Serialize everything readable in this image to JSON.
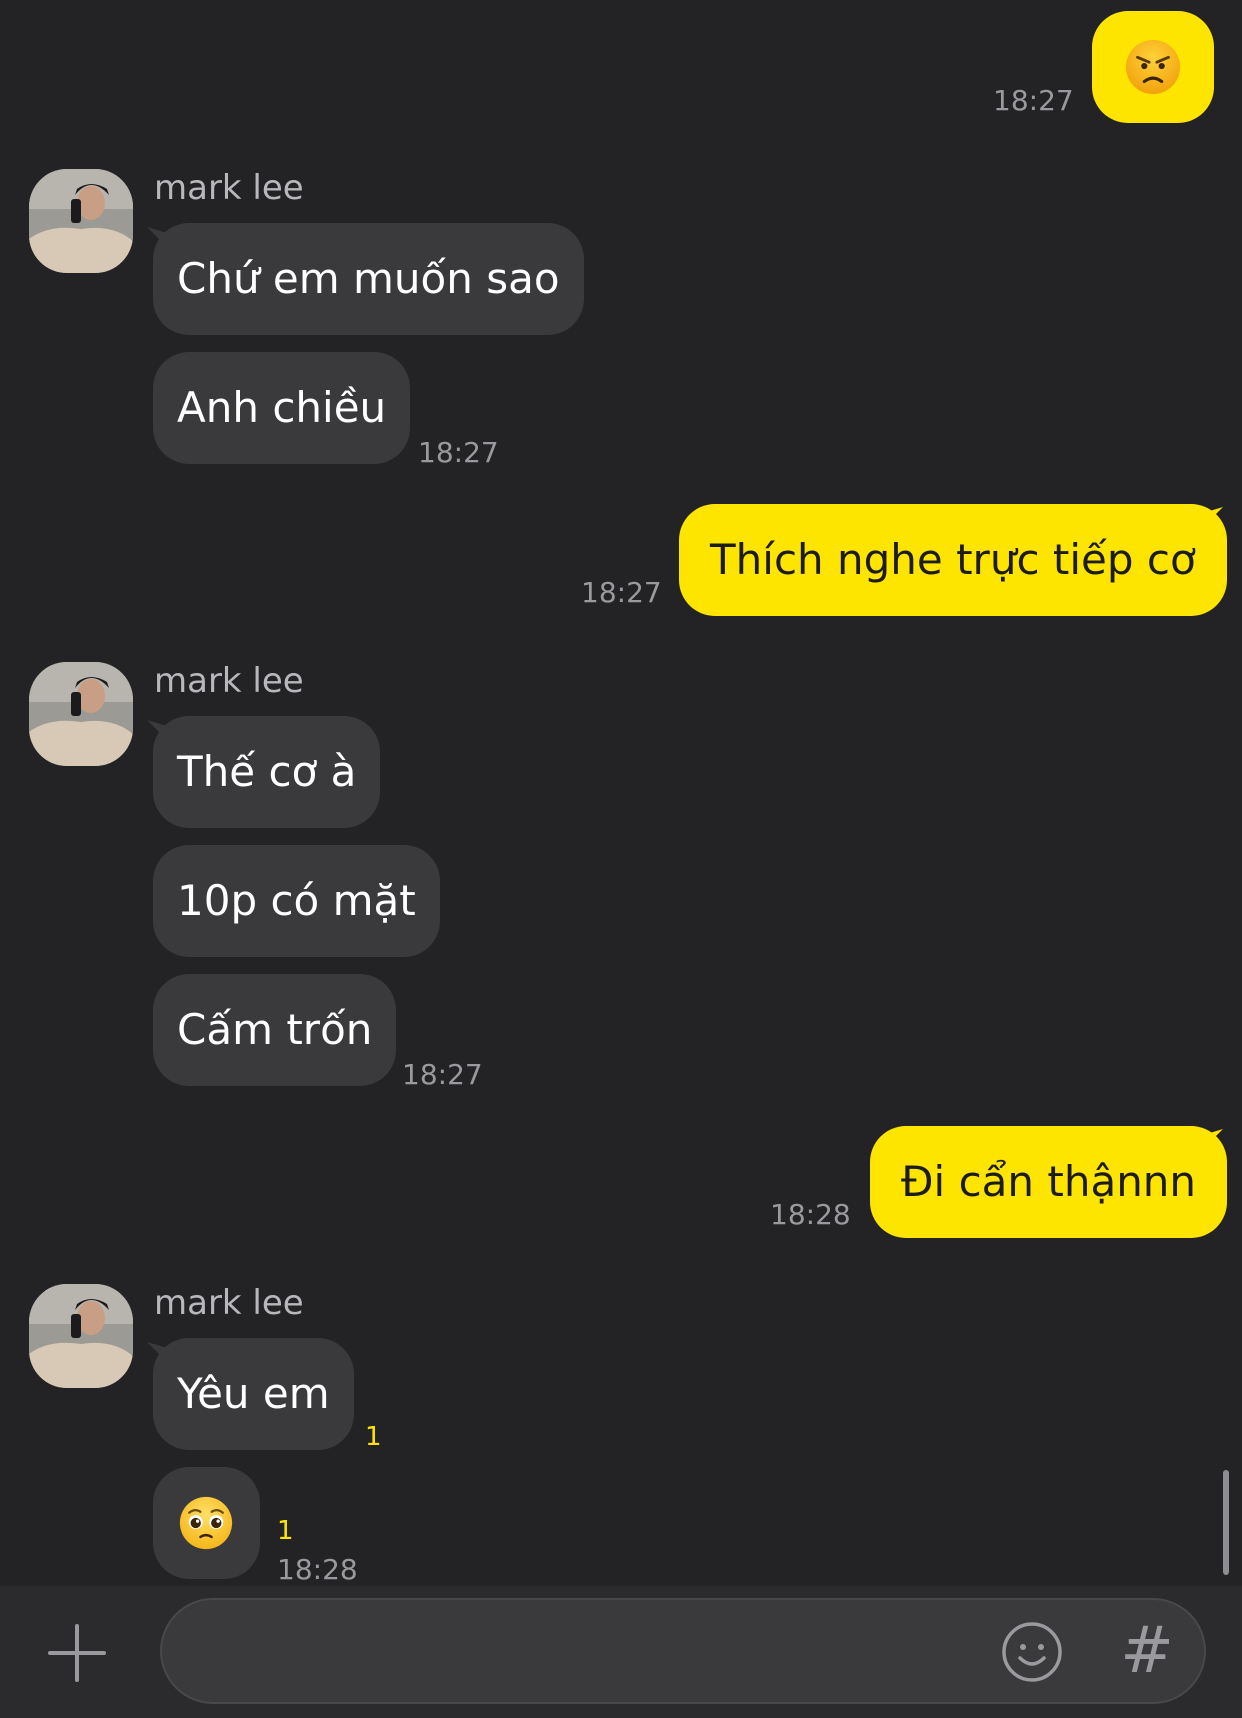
{
  "app": {
    "accent_color": "#fee500",
    "background_color": "#232326",
    "incoming_bubble_color": "#3a3a3d"
  },
  "messages": {
    "m1": {
      "direction": "outgoing",
      "emoji": "pouting-face",
      "time": "18:27"
    },
    "group1": {
      "sender": "mark lee",
      "bubble1": "Chứ em muốn sao",
      "bubble2": "Anh chiều",
      "time": "18:27"
    },
    "m2": {
      "direction": "outgoing",
      "text": "Thích nghe trực tiếp cơ",
      "time": "18:27"
    },
    "group2": {
      "sender": "mark lee",
      "bubble1": "Thế cơ à",
      "bubble2": "10p có mặt",
      "bubble3": "Cấm trốn",
      "time": "18:27"
    },
    "m3": {
      "direction": "outgoing",
      "text": "Đi cẩn thậnnn",
      "time": "18:28"
    },
    "group3": {
      "sender": "mark lee",
      "bubble1": "Yêu em",
      "bubble1_unread": "1",
      "bubble2_emoji": "pleading-face",
      "bubble2_unread": "1",
      "time": "18:28"
    }
  },
  "composer": {
    "plus_icon": "plus-icon",
    "input_value": "",
    "emoji_icon": "emoji-icon",
    "hash_label": "#"
  }
}
